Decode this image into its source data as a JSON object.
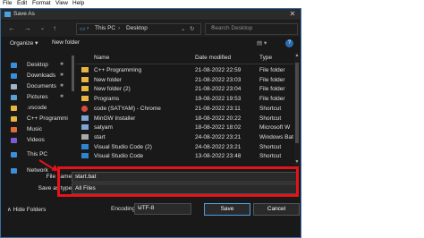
{
  "menubar": {
    "items": [
      "File",
      "Edit",
      "Format",
      "View",
      "Help"
    ]
  },
  "dialog": {
    "title": "Save As"
  },
  "address": {
    "root": "This PC",
    "folder": "Desktop"
  },
  "search": {
    "placeholder": "Search Desktop"
  },
  "cmd": {
    "organize": "Organize ▾",
    "new_folder": "New folder"
  },
  "sidebar": {
    "items": [
      {
        "label": "Desktop",
        "pinned": true,
        "icon": "desktop-icon",
        "color": "#3b8fd9"
      },
      {
        "label": "Downloads",
        "pinned": true,
        "icon": "download-icon",
        "color": "#3b8fd9"
      },
      {
        "label": "Documents",
        "pinned": true,
        "icon": "documents-icon",
        "color": "#9fb4c8"
      },
      {
        "label": "Pictures",
        "pinned": true,
        "icon": "pictures-icon",
        "color": "#5aa0d6"
      },
      {
        "label": ".vscode",
        "pinned": false,
        "icon": "folder-icon",
        "color": "#e8b640"
      },
      {
        "label": "C++ Programmi",
        "pinned": false,
        "icon": "folder-icon",
        "color": "#e8b640"
      },
      {
        "label": "Music",
        "pinned": false,
        "icon": "music-icon",
        "color": "#e06c3a"
      },
      {
        "label": "Videos",
        "pinned": false,
        "icon": "videos-icon",
        "color": "#7b5cd6"
      },
      {
        "label": "This PC",
        "pinned": false,
        "icon": "computer-icon",
        "color": "#3b8fd9"
      },
      {
        "label": "Network",
        "pinned": false,
        "icon": "network-icon",
        "color": "#3b8fd9"
      }
    ]
  },
  "filelist": {
    "headers": {
      "name": "Name",
      "date": "Date modified",
      "type": "Type"
    },
    "rows": [
      {
        "name": "C++ Programming",
        "date": "21-08-2022 22:59",
        "type": "File folder",
        "kind": "folder"
      },
      {
        "name": "New folder",
        "date": "21-08-2022 23:03",
        "type": "File folder",
        "kind": "folder"
      },
      {
        "name": "New folder (2)",
        "date": "21-08-2022 23:04",
        "type": "File folder",
        "kind": "folder"
      },
      {
        "name": "Programs",
        "date": "19-08-2022 19:53",
        "type": "File folder",
        "kind": "folder"
      },
      {
        "name": "code (SATYAM) - Chrome",
        "date": "21-08-2022 23:11",
        "type": "Shortcut",
        "kind": "chrome"
      },
      {
        "name": "MinGW Installer",
        "date": "18-08-2022 20:22",
        "type": "Shortcut",
        "kind": "file"
      },
      {
        "name": "satyam",
        "date": "18-08-2022 18:02",
        "type": "Microsoft W",
        "kind": "file"
      },
      {
        "name": "start",
        "date": "24-08-2022 23:21",
        "type": "Windows Bat",
        "kind": "bat"
      },
      {
        "name": "Visual Studio Code (2)",
        "date": "24-08-2022 23:21",
        "type": "Shortcut",
        "kind": "vsc"
      },
      {
        "name": "Visual Studio Code",
        "date": "13-08-2022 23:48",
        "type": "Shortcut",
        "kind": "vsc"
      }
    ]
  },
  "form": {
    "file_name_label": "File name:",
    "file_name_value": "start.bat",
    "save_type_label": "Save as type:",
    "save_type_value": "All Files"
  },
  "footer": {
    "hide_folders": "∧ Hide Folders",
    "encoding_label": "Encoding:",
    "encoding_value": "UTF-8",
    "save": "Save",
    "cancel": "Cancel"
  },
  "colors": {
    "annotation_red": "#e6121a",
    "accent": "#4f9de2",
    "background": "#191919"
  }
}
